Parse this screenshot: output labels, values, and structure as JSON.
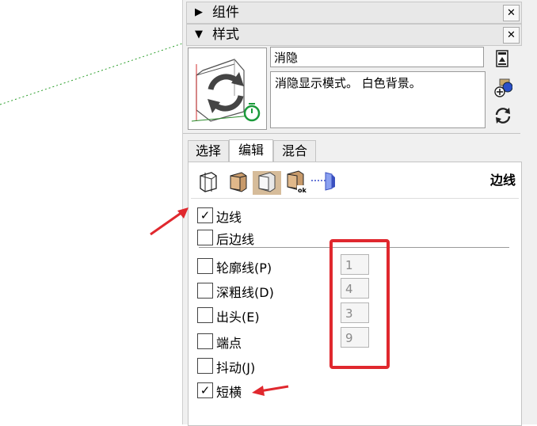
{
  "trays": {
    "components": {
      "arrow": "▶",
      "title": "组件",
      "close": "✕"
    },
    "styles": {
      "arrow": "▼",
      "title": "样式",
      "close": "✕"
    }
  },
  "style": {
    "name": "消隐",
    "description": "消隐显示模式。 白色背景。"
  },
  "tabs": [
    {
      "label": "选择"
    },
    {
      "label": "编辑"
    },
    {
      "label": "混合"
    }
  ],
  "edit": {
    "section_label": "边线",
    "options": [
      {
        "label": "边线",
        "checked": "✓"
      },
      {
        "label": "后边线",
        "checked": ""
      },
      {
        "label": "轮廓线(P)",
        "checked": ""
      },
      {
        "label": "深粗线(D)",
        "checked": ""
      },
      {
        "label": "出头(E)",
        "checked": ""
      },
      {
        "label": "端点",
        "checked": ""
      },
      {
        "label": "抖动(J)",
        "checked": ""
      },
      {
        "label": "短横",
        "checked": "✓"
      }
    ],
    "values": {
      "profiles": "1",
      "depth_cue": "4",
      "extension": "3",
      "endpoints": "9"
    }
  },
  "annotation_color": "#e0282e"
}
